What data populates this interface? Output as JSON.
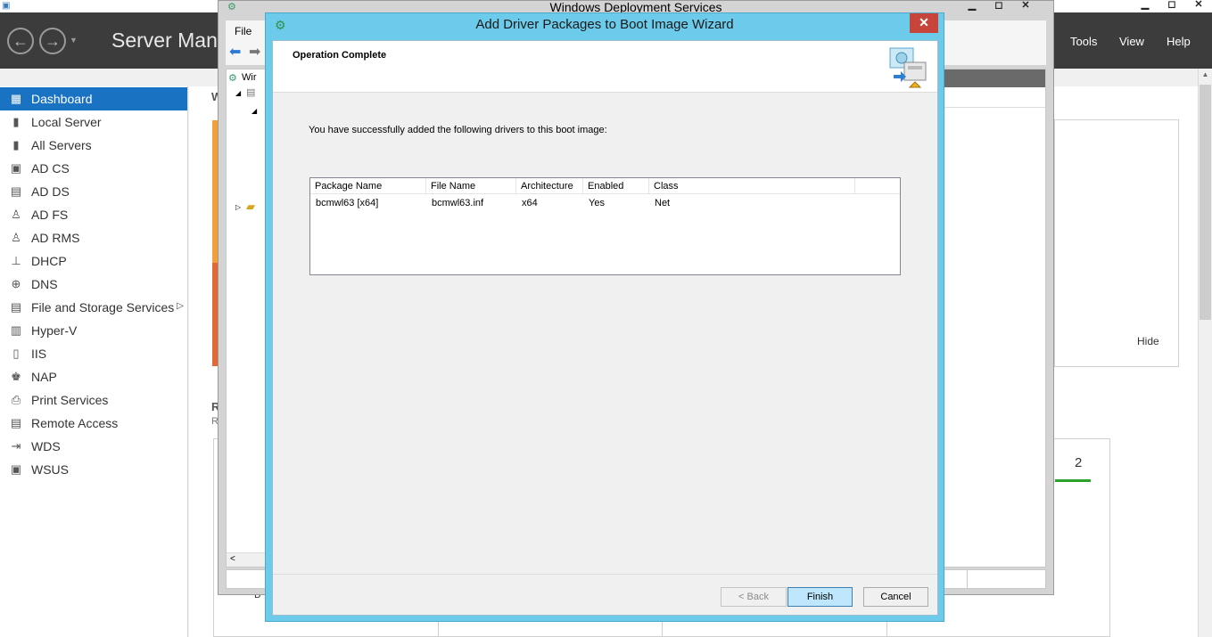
{
  "server_manager": {
    "title": "Server Mana",
    "menu": {
      "tools": "Tools",
      "view": "View",
      "help": "Help"
    },
    "nav_items": [
      {
        "label": "Dashboard",
        "icon": "dashboard-icon",
        "glyph": "▦",
        "active": true
      },
      {
        "label": "Local Server",
        "icon": "server-icon",
        "glyph": "▮"
      },
      {
        "label": "All Servers",
        "icon": "servers-icon",
        "glyph": "▮"
      },
      {
        "label": "AD CS",
        "icon": "ad-cs-icon",
        "glyph": "▣"
      },
      {
        "label": "AD DS",
        "icon": "ad-ds-icon",
        "glyph": "▤"
      },
      {
        "label": "AD FS",
        "icon": "ad-fs-icon",
        "glyph": "♙"
      },
      {
        "label": "AD RMS",
        "icon": "ad-rms-icon",
        "glyph": "♙"
      },
      {
        "label": "DHCP",
        "icon": "dhcp-icon",
        "glyph": "⊥"
      },
      {
        "label": "DNS",
        "icon": "dns-icon",
        "glyph": "⊕"
      },
      {
        "label": "File and Storage Services",
        "icon": "file-storage-icon",
        "glyph": "▤",
        "has_arrow": true
      },
      {
        "label": "Hyper-V",
        "icon": "hyper-v-icon",
        "glyph": "▥"
      },
      {
        "label": "IIS",
        "icon": "iis-icon",
        "glyph": "▯"
      },
      {
        "label": "NAP",
        "icon": "nap-icon",
        "glyph": "♚"
      },
      {
        "label": "Print Services",
        "icon": "printer-icon",
        "glyph": "⎙"
      },
      {
        "label": "Remote Access",
        "icon": "remote-access-icon",
        "glyph": "▤"
      },
      {
        "label": "WDS",
        "icon": "wds-icon",
        "glyph": "⇥"
      },
      {
        "label": "WSUS",
        "icon": "wsus-icon",
        "glyph": "▣"
      }
    ],
    "hide_link": "Hide",
    "tile_count": "2"
  },
  "wds_console": {
    "title": "Windows Deployment Services",
    "menu_file": "File",
    "tree_root": "Wir"
  },
  "wizard": {
    "title": "Add Driver Packages to Boot Image Wizard",
    "heading": "Operation Complete",
    "message": "You have successfully added the following drivers to this boot image:",
    "columns": [
      "Package Name",
      "File Name",
      "Architecture",
      "Enabled",
      "Class"
    ],
    "rows": [
      [
        "bcmwl63 [x64]",
        "bcmwl63.inf",
        "x64",
        "Yes",
        "Net"
      ]
    ],
    "buttons": {
      "back": "< Back",
      "finish": "Finish",
      "cancel": "Cancel"
    }
  }
}
